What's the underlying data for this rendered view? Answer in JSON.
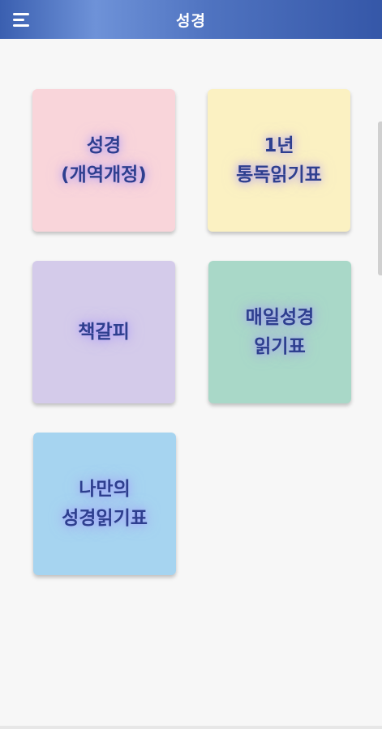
{
  "header": {
    "title": "성경",
    "menu_icon": "menu-icon"
  },
  "tiles": [
    {
      "line1": "성경",
      "line2": "(개역개정)",
      "color": "#f9d5da"
    },
    {
      "line1": "1년",
      "line2": "통독읽기표",
      "color": "#fbf1c2"
    },
    {
      "line1": "책갈피",
      "line2": "",
      "color": "#d4cbea"
    },
    {
      "line1": "매일성경",
      "line2": "읽기표",
      "color": "#a9d8c8"
    },
    {
      "line1": "나만의",
      "line2": "성경읽기표",
      "color": "#a6d4f0"
    }
  ],
  "colors": {
    "header_gradient_start": "#3a5fb0",
    "header_gradient_highlight": "#6e92d8",
    "label_text": "#2e3f8f",
    "background": "#f7f7f7"
  }
}
